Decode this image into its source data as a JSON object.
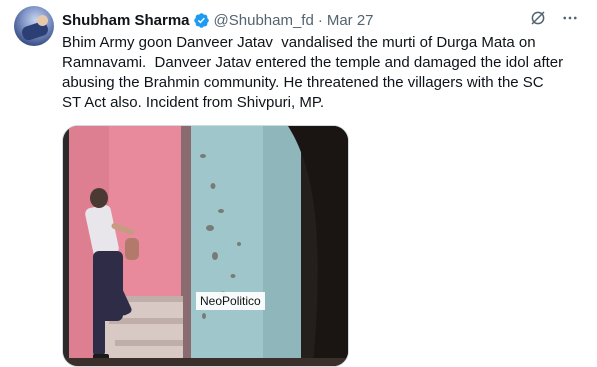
{
  "tweet": {
    "author": {
      "name": "Shubham Sharma",
      "handle": "@Shubham_fd",
      "separator": "·",
      "date": "Mar 27"
    },
    "text": "Bhim Army goon Danveer Jatav  vandalised the murti of Durga Mata on\nRamnavami.  Danveer Jatav entered the temple and damaged the idol after\nabusing the Brahmin community. He threatened the villagers with the SC\nST Act also. Incident from Shivpuri, MP.",
    "media": {
      "watermark": "NeoPolitico"
    }
  },
  "icons": {
    "verified": "verified-badge-icon",
    "grok": "grok-icon",
    "more": "more-options-icon"
  },
  "colors": {
    "verified_blue": "#1d9bf0",
    "secondary_text": "#536471",
    "primary_text": "#0f1419",
    "wall_pink": "#e98a9c",
    "wall_blue": "#9fc6ca"
  }
}
